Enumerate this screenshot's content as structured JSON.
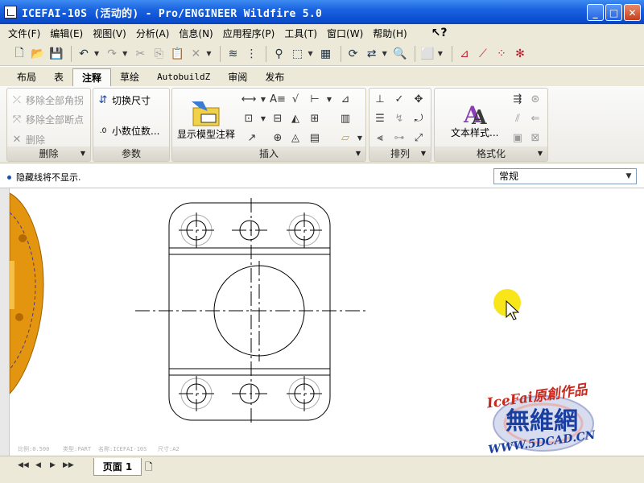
{
  "window": {
    "title": "ICEFAI-10S (活动的) - Pro/ENGINEER Wildfire 5.0",
    "minimize_glyph": "_",
    "maximize_glyph": "□",
    "close_glyph": "✕"
  },
  "menu": [
    "文件(F)",
    "编辑(E)",
    "视图(V)",
    "分析(A)",
    "信息(N)",
    "应用程序(P)",
    "工具(T)",
    "窗口(W)",
    "帮助(H)"
  ],
  "ribbon_tabs": [
    "布局",
    "表",
    "注释",
    "草绘",
    "AutobuildZ",
    "审阅",
    "发布"
  ],
  "active_tab": "注释",
  "ribbon": {
    "delete_group": {
      "label": "删除",
      "remove_all_cross": "移除全部角拐",
      "remove_all_break": "移除全部断点",
      "delete": "删除"
    },
    "params_group": {
      "label": "参数",
      "toggle_dims": "切换尺寸",
      "decimal": "小数位数..."
    },
    "insert_group": {
      "label": "插入",
      "show_model_annotations": "显示模型注释"
    },
    "arrange_group": {
      "label": "排列"
    },
    "format_group": {
      "label": "格式化",
      "text_style": "文本样式..."
    }
  },
  "message": "隐藏线将不显示.",
  "filter": {
    "value": "常规"
  },
  "canvas_labels": {
    "scale": "比例:0.500",
    "type": "类型:PART",
    "name": "名称:ICEFAI-10S",
    "size": "尺寸:A2"
  },
  "page_tab": "页面 1",
  "watermark": {
    "line1": "IceFai原創作品",
    "line2": "無維網",
    "line3": "WWW.5DCAD.CN"
  },
  "colors": {
    "title_bar": "#0b4fd1",
    "chrome": "#ece9d8",
    "model_orange": "#e39510",
    "cursor_highlight": "#f8e61b",
    "watermark_red": "#c8291f",
    "watermark_blue": "#1a3fa0"
  }
}
